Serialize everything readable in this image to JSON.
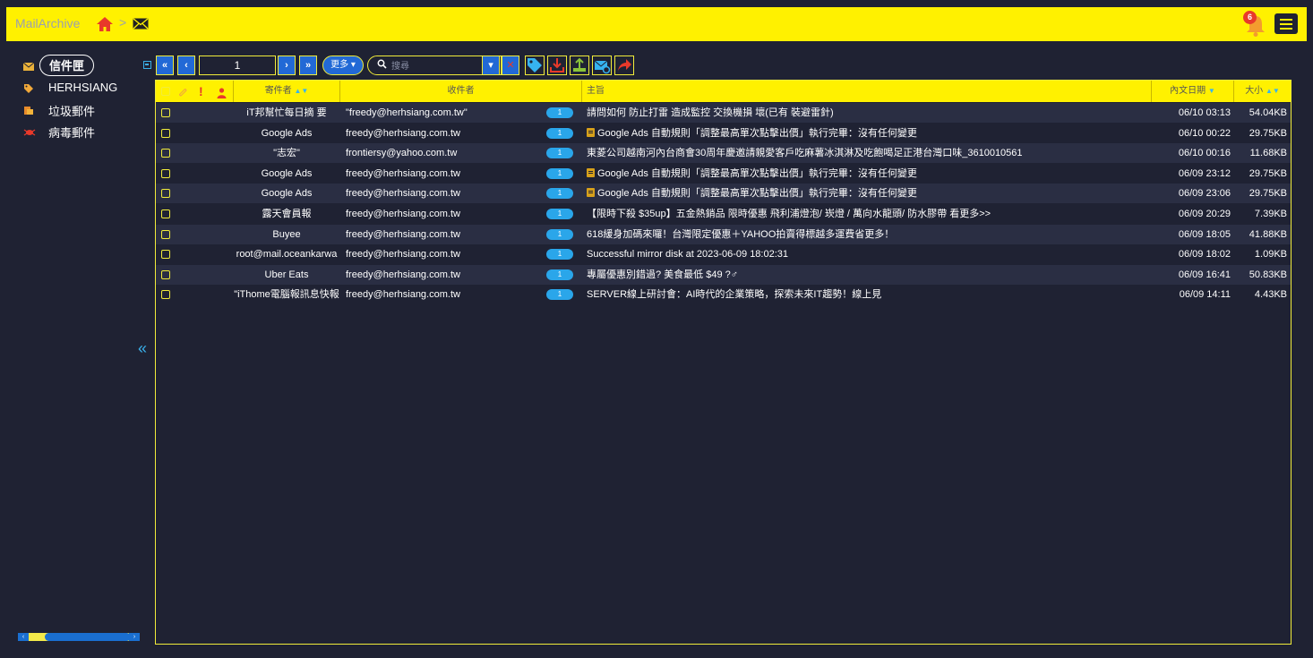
{
  "app": {
    "title": "MailArchive",
    "breadcrumb_separator": ">"
  },
  "header": {
    "notification_count": "6"
  },
  "sidebar": {
    "items": [
      {
        "label": "信件匣",
        "icon": "envelope-icon",
        "active": true
      },
      {
        "label": "HERHSIANG",
        "icon": "tag-icon"
      },
      {
        "label": "垃圾郵件",
        "icon": "trash-icon"
      },
      {
        "label": "病毒郵件",
        "icon": "bug-icon"
      }
    ],
    "toggle": "«"
  },
  "toolbar": {
    "first": "«",
    "prev": "‹",
    "page": "1",
    "next": "›",
    "last": "»",
    "more_label": "更多",
    "search_placeholder": "搜尋"
  },
  "grid": {
    "columns": {
      "sender": "寄件者",
      "recipient": "收件者",
      "subject": "主旨",
      "date": "內文日期",
      "size": "大小"
    },
    "rows": [
      {
        "sender": "iT邦幫忙每日摘 要",
        "recipient": "\"freedy@herhsiang.com.tw\"",
        "count": "1",
        "subject": "請問如何 防止打雷 造成監控 交換機損 壞(已有 裝避雷針)",
        "flag": false,
        "date": "06/10 03:13",
        "size": "54.04KB"
      },
      {
        "sender": "Google Ads",
        "recipient": "freedy@herhsiang.com.tw",
        "count": "1",
        "subject": "Google Ads 自動規則「調整最高單次點擊出價」執行完畢：沒有任何變更",
        "flag": true,
        "date": "06/10 00:22",
        "size": "29.75KB"
      },
      {
        "sender": "\"志宏\"",
        "recipient": "frontiersy@yahoo.com.tw",
        "count": "1",
        "subject": "東菱公司越南河內台商會30周年慶邀請親愛客戶吃麻薯冰淇淋及吃飽喝足正港台灣口味_3610010561",
        "flag": false,
        "date": "06/10 00:16",
        "size": "11.68KB"
      },
      {
        "sender": "Google Ads",
        "recipient": "freedy@herhsiang.com.tw",
        "count": "1",
        "subject": "Google Ads 自動規則「調整最高單次點擊出價」執行完畢：沒有任何變更",
        "flag": true,
        "date": "06/09 23:12",
        "size": "29.75KB"
      },
      {
        "sender": "Google Ads",
        "recipient": "freedy@herhsiang.com.tw",
        "count": "1",
        "subject": "Google Ads 自動規則「調整最高單次點擊出價」執行完畢：沒有任何變更",
        "flag": true,
        "date": "06/09 23:06",
        "size": "29.75KB"
      },
      {
        "sender": "露天會員報",
        "recipient": "freedy@herhsiang.com.tw",
        "count": "1",
        "subject": "【限時下殺 $35up】五金熱銷品 限時優惠 飛利浦燈泡/ 崁燈 / 萬向水龍頭/ 防水膠帶 看更多>>",
        "flag": false,
        "date": "06/09 20:29",
        "size": "7.39KB"
      },
      {
        "sender": "Buyee",
        "recipient": "freedy@herhsiang.com.tw",
        "count": "1",
        "subject": "618緩身加碼來囉！台灣限定優惠＋YAHOO拍賣得標越多運費省更多！",
        "flag": false,
        "date": "06/09 18:05",
        "size": "41.88KB"
      },
      {
        "sender": "root@mail.oceankarwa",
        "recipient": "freedy@herhsiang.com.tw",
        "count": "1",
        "subject": "Successful mirror disk at 2023-06-09 18:02:31",
        "flag": false,
        "date": "06/09 18:02",
        "size": "1.09KB"
      },
      {
        "sender": "Uber Eats",
        "recipient": "freedy@herhsiang.com.tw",
        "count": "1",
        "subject": "專屬優惠別錯過? 美食最低 $49 ?♂",
        "flag": false,
        "date": "06/09 16:41",
        "size": "50.83KB"
      },
      {
        "sender": "\"iThome電腦報訊息快報",
        "recipient": "freedy@herhsiang.com.tw",
        "count": "1",
        "subject": "SERVER線上研討會：AI時代的企業策略，探索未來IT趨勢！線上見",
        "flag": false,
        "date": "06/09 14:11",
        "size": "4.43KB"
      }
    ]
  },
  "colors": {
    "accent": "#fff100",
    "background": "#1f2233",
    "button": "#2269d6",
    "badge": "#2aa6ea"
  }
}
